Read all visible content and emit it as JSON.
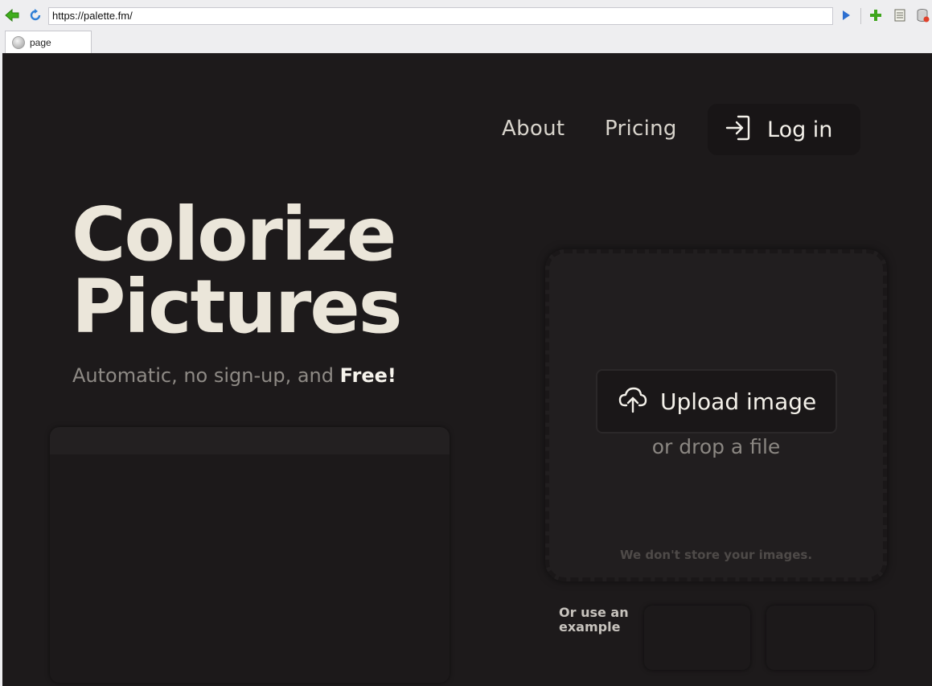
{
  "browser": {
    "url": "https://palette.fm/",
    "tab_title": "page"
  },
  "nav": {
    "about": "About",
    "pricing": "Pricing",
    "login": "Log in"
  },
  "hero": {
    "title_line1": "Colorize",
    "title_line2": "Pictures",
    "subtitle": "Automatic, no sign-up, and ",
    "subtitle_emphasis": "Free!"
  },
  "upload": {
    "button_label": "Upload image",
    "drop_text": "or drop a file",
    "privacy_note": "We don't store your images."
  },
  "examples": {
    "label": "Or use an example"
  },
  "colors": {
    "page_background": "#1d1a1b",
    "title_text": "#ebe6da",
    "muted_text": "#8e8a85"
  }
}
